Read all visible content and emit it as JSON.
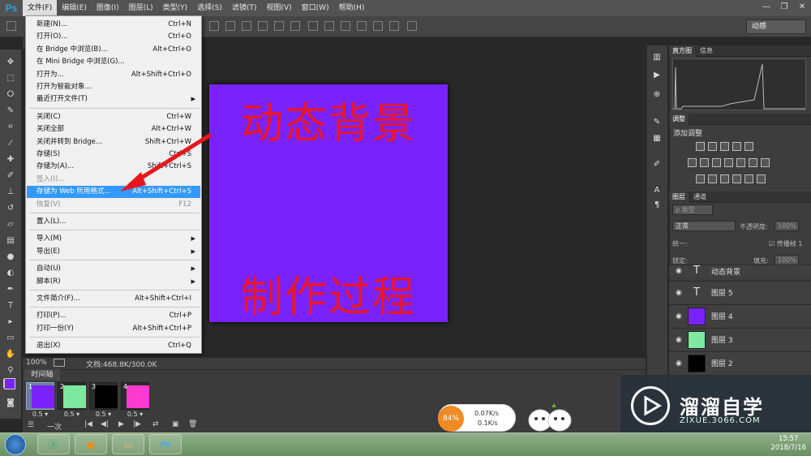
{
  "app": {
    "logo": "Ps"
  },
  "menubar": [
    "文件(F)",
    "编辑(E)",
    "图像(I)",
    "图层(L)",
    "类型(Y)",
    "选择(S)",
    "滤镜(T)",
    "视图(V)",
    "窗口(W)",
    "帮助(H)"
  ],
  "options": {
    "workspace": "动感"
  },
  "file_menu": [
    {
      "label": "新建(N)...",
      "shortcut": "Ctrl+N"
    },
    {
      "label": "打开(O)...",
      "shortcut": "Ctrl+O"
    },
    {
      "label": "在 Bridge 中浏览(B)...",
      "shortcut": "Alt+Ctrl+O"
    },
    {
      "label": "在 Mini Bridge 中浏览(G)...",
      "shortcut": ""
    },
    {
      "label": "打开为...",
      "shortcut": "Alt+Shift+Ctrl+O"
    },
    {
      "label": "打开为智能对象...",
      "shortcut": ""
    },
    {
      "label": "最近打开文件(T)",
      "shortcut": ""
    },
    {
      "label": "关闭(C)",
      "shortcut": "Ctrl+W"
    },
    {
      "label": "关闭全部",
      "shortcut": "Alt+Ctrl+W"
    },
    {
      "label": "关闭并转到 Bridge...",
      "shortcut": "Shift+Ctrl+W"
    },
    {
      "label": "存储(S)",
      "shortcut": "Ctrl+S"
    },
    {
      "label": "存储为(A)...",
      "shortcut": "Shift+Ctrl+S"
    },
    {
      "label": "签入(I)...",
      "shortcut": ""
    },
    {
      "label": "存储为 Web 所用格式...",
      "shortcut": "Alt+Shift+Ctrl+S"
    },
    {
      "label": "恢复(V)",
      "shortcut": "F12"
    },
    {
      "label": "置入(L)...",
      "shortcut": ""
    },
    {
      "label": "导入(M)",
      "shortcut": ""
    },
    {
      "label": "导出(E)",
      "shortcut": ""
    },
    {
      "label": "自动(U)",
      "shortcut": ""
    },
    {
      "label": "脚本(R)",
      "shortcut": ""
    },
    {
      "label": "文件简介(F)...",
      "shortcut": "Alt+Shift+Ctrl+I"
    },
    {
      "label": "打印(P)...",
      "shortcut": "Ctrl+P"
    },
    {
      "label": "打印一份(Y)",
      "shortcut": "Alt+Shift+Ctrl+P"
    },
    {
      "label": "退出(X)",
      "shortcut": "Ctrl+Q"
    }
  ],
  "canvas": {
    "top_text": "动态背景",
    "bottom_text": "制作过程",
    "bg": "#7a22fb",
    "text_color": "#e8162c"
  },
  "status": {
    "zoom": "100%",
    "doc": "文档:468.8K/300.0K"
  },
  "timeline": {
    "tab": "时间轴",
    "frames": [
      {
        "num": "1",
        "delay": "0.5",
        "color": "#7a22fb"
      },
      {
        "num": "2",
        "delay": "0.5",
        "color": "#7de8a0"
      },
      {
        "num": "3",
        "delay": "0.5",
        "color": "#000000"
      },
      {
        "num": "4",
        "delay": "0.5",
        "color": "#ff3ad0"
      }
    ],
    "loop": "一次"
  },
  "panels": {
    "histogram_tab": "直方图",
    "info_tab": "信息",
    "adjust_tab": "调整",
    "adjust_add": "添加调整",
    "layers_tab": "图层",
    "channels_tab": "通道",
    "filter": "ρ 类型",
    "blend": "正常",
    "opacity_label": "不透明度:",
    "opacity": "100%",
    "unify_label": "统一:",
    "propagate": "传播帧 1",
    "lock_label": "锁定:",
    "fill_label": "填充:",
    "fill": "100%",
    "layers": [
      {
        "name": "动态背景",
        "kind": "text"
      },
      {
        "name": "图层 5",
        "kind": "text"
      },
      {
        "name": "图层 4",
        "kind": "color",
        "color": "#7a22fb"
      },
      {
        "name": "图层 3",
        "kind": "color",
        "color": "#7de8a0"
      },
      {
        "name": "图层 2",
        "kind": "color",
        "color": "#000000"
      }
    ]
  },
  "net_widget": {
    "percent": "84%",
    "up": "0.07K/s",
    "down": "0.1K/s"
  },
  "watermark": {
    "title": "溜溜自学",
    "url": "ZIXUE.3066.COM"
  },
  "clock": {
    "time": "15:57",
    "date": "2018/7/16"
  }
}
